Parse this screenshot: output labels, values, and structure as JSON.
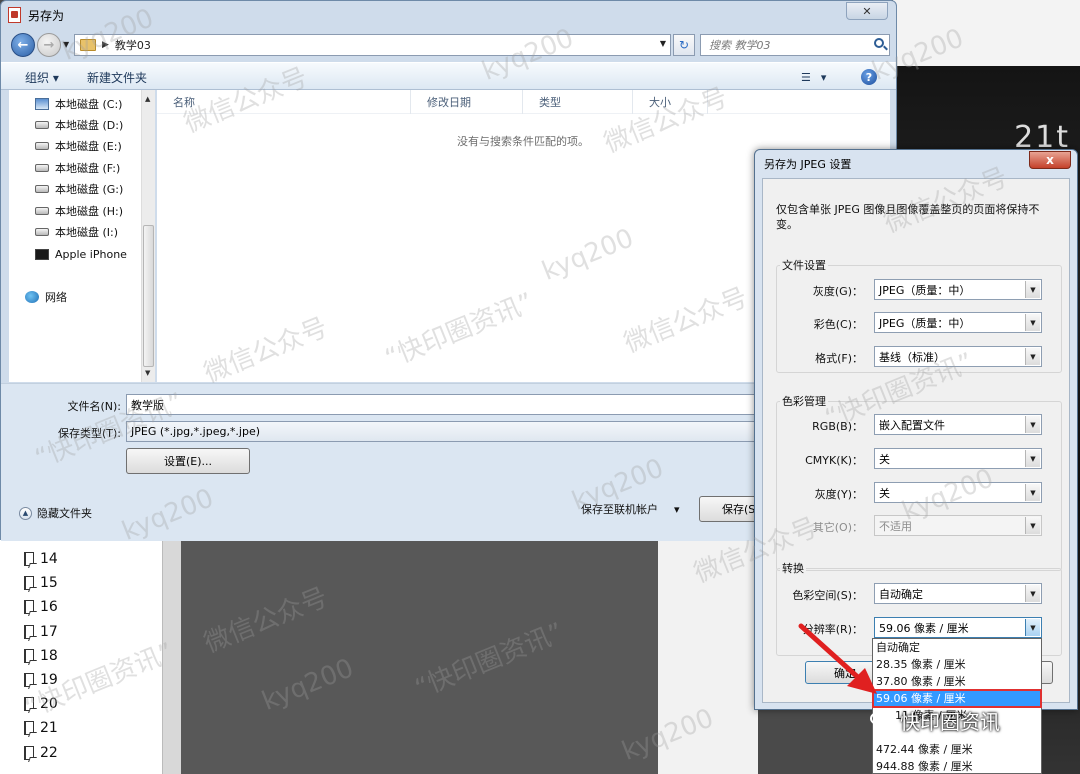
{
  "save_dialog": {
    "title": "另存为",
    "address": {
      "path": "教学03"
    },
    "search": {
      "placeholder": "搜索 教学03"
    },
    "toolbar": {
      "organize": "组织 ▾",
      "new_folder": "新建文件夹",
      "view_icon": "list-view-icon",
      "help": "?"
    },
    "nav_items": [
      {
        "label": "本地磁盘 (C:)",
        "icon": "system-drive-icon"
      },
      {
        "label": "本地磁盘 (D:)",
        "icon": "drive-icon"
      },
      {
        "label": "本地磁盘 (E:)",
        "icon": "drive-icon"
      },
      {
        "label": "本地磁盘 (F:)",
        "icon": "drive-icon"
      },
      {
        "label": "本地磁盘 (G:)",
        "icon": "drive-icon"
      },
      {
        "label": "本地磁盘 (H:)",
        "icon": "drive-icon"
      },
      {
        "label": "本地磁盘 (I:)",
        "icon": "drive-icon"
      },
      {
        "label": "Apple iPhone",
        "icon": "phone-icon"
      },
      {
        "label": "网络",
        "icon": "network-icon"
      }
    ],
    "columns": [
      "名称",
      "修改日期",
      "类型",
      "大小"
    ],
    "empty_message": "没有与搜索条件匹配的项。",
    "filename_label": "文件名(N):",
    "filename_value": "教学版",
    "filetype_label": "保存类型(T):",
    "filetype_value": "JPEG (*.jpg,*.jpeg,*.jpe)",
    "settings_button": "设置(E)...",
    "hide_folders": "隐藏文件夹",
    "save_online": "保存至联机帐户",
    "save_button": "保存(S)"
  },
  "jpeg_dialog": {
    "title": "另存为 JPEG 设置",
    "close": "x",
    "description": "仅包含单张 JPEG 图像且图像覆盖整页的页面将保持不变。",
    "file_settings": {
      "title": "文件设置",
      "rows": [
        {
          "label": "灰度(G)：",
          "value": "JPEG（质量：中）"
        },
        {
          "label": "彩色(C)：",
          "value": "JPEG（质量：中）"
        },
        {
          "label": "格式(F)：",
          "value": "基线（标准）"
        }
      ]
    },
    "color_management": {
      "title": "色彩管理",
      "rows": [
        {
          "label": "RGB(B)：",
          "value": "嵌入配置文件"
        },
        {
          "label": "CMYK(K)：",
          "value": "关"
        },
        {
          "label": "灰度(Y)：",
          "value": "关"
        },
        {
          "label": "其它(O)：",
          "value": "不适用"
        }
      ]
    },
    "conversion": {
      "title": "转换",
      "rows": [
        {
          "label": "色彩空间(S)：",
          "value": "自动确定"
        },
        {
          "label": "分辨率(R)：",
          "value": "59.06 像素 / 厘米"
        }
      ]
    },
    "ok_button": "确定",
    "cancel_button": "取消",
    "resolution_options": [
      "自动确定",
      "28.35 像素 / 厘米",
      "37.80 像素 / 厘米",
      "59.06 像素 / 厘米",
      "11 像素 / 厘米",
      "",
      "472.44 像素 / 厘米",
      "944.88 像素 / 厘米"
    ],
    "selected_option_index": 3
  },
  "background": {
    "page_numbers": [
      "14",
      "15",
      "16",
      "17",
      "18",
      "19",
      "20",
      "21",
      "22"
    ],
    "right_text": "21t"
  },
  "watermark": {
    "texts": [
      "kyq200",
      "微信公众号",
      "“快印圈资讯”"
    ],
    "badge": "快印圈资讯"
  }
}
